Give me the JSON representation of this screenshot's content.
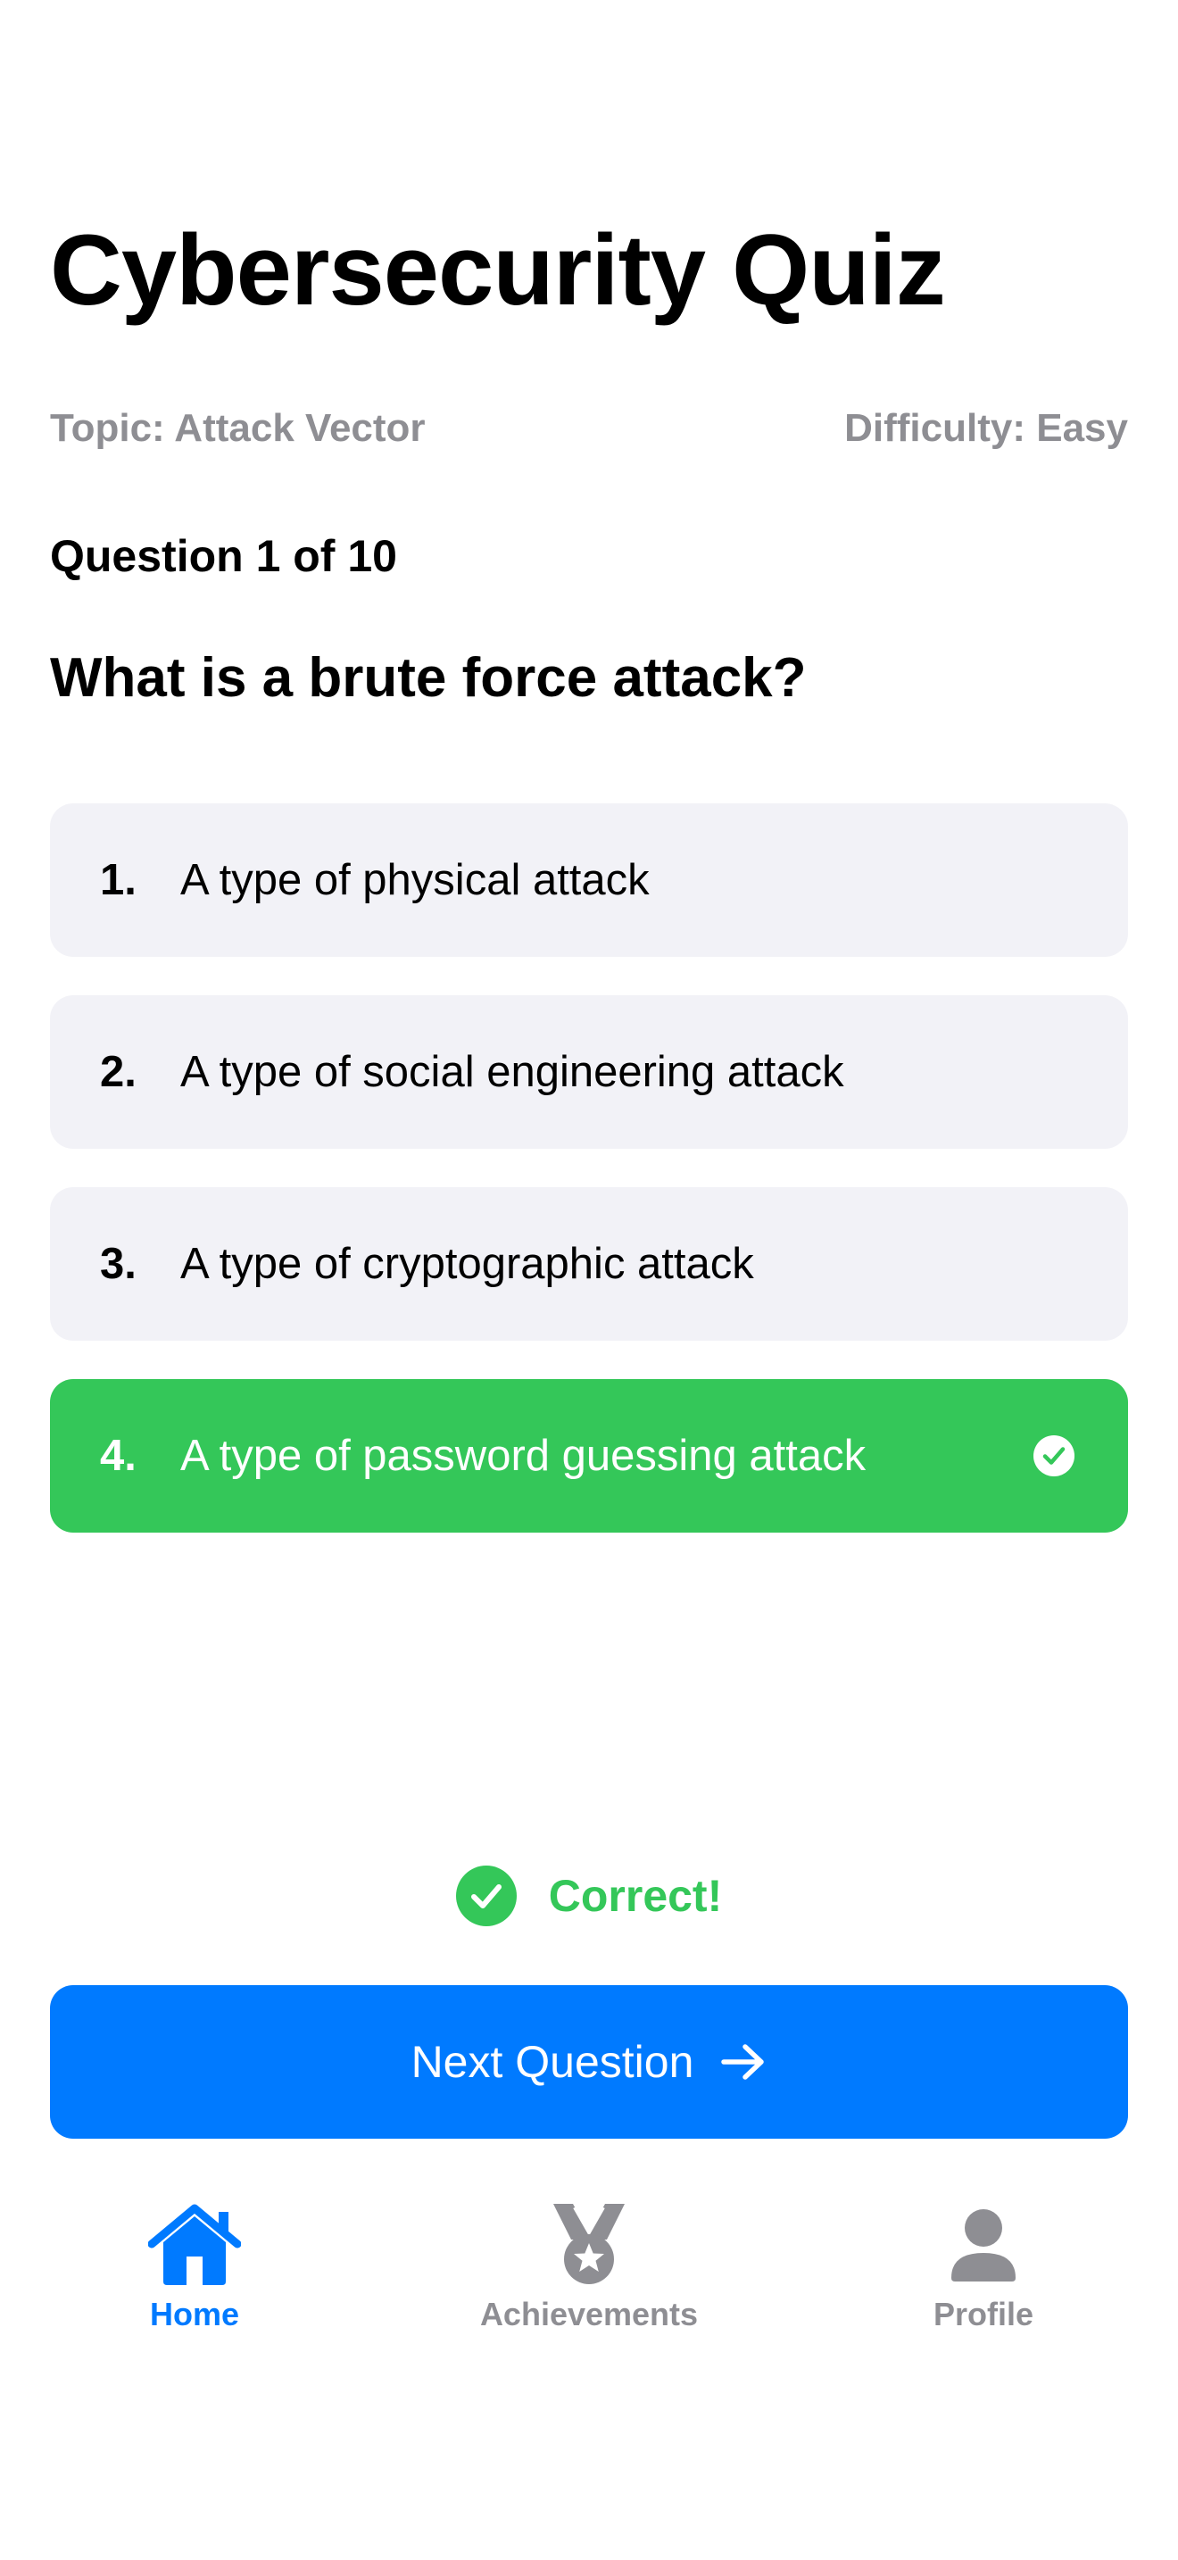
{
  "header": {
    "title": "Cybersecurity Quiz",
    "topic": "Topic: Attack Vector",
    "difficulty": "Difficulty: Easy"
  },
  "quiz": {
    "counter": "Question 1 of 10",
    "question": "What is a brute force attack?",
    "options": [
      {
        "number": "1.",
        "text": "A type of physical attack",
        "state": "default"
      },
      {
        "number": "2.",
        "text": "A type of social engineering attack",
        "state": "default"
      },
      {
        "number": "3.",
        "text": "A type of cryptographic attack",
        "state": "default"
      },
      {
        "number": "4.",
        "text": "A type of password guessing attack",
        "state": "correct",
        "icon": "checkmark-circle-icon"
      }
    ],
    "feedback": {
      "text": "Correct!",
      "icon": "checkmark-circle-fill-icon"
    },
    "next_button": {
      "label": "Next Question",
      "icon": "arrow-right-icon"
    }
  },
  "tabbar": {
    "items": [
      {
        "label": "Home",
        "icon": "house-icon",
        "active": true
      },
      {
        "label": "Achievements",
        "icon": "medal-icon",
        "active": false
      },
      {
        "label": "Profile",
        "icon": "person-icon",
        "active": false
      }
    ]
  },
  "colors": {
    "accent": "#007aff",
    "success": "#34c759",
    "secondary_text": "#8e8e93",
    "option_background": "#f2f2f7"
  }
}
